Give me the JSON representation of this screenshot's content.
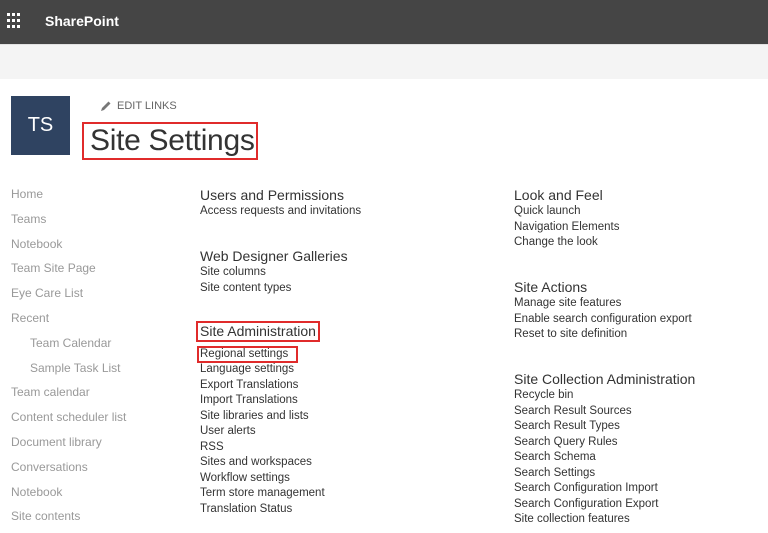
{
  "suite_bar": {
    "brand": "SharePoint",
    "waffle_icon": "app-launcher-icon"
  },
  "header": {
    "logo_initials": "TS",
    "edit_links_label": "EDIT LINKS",
    "page_title": "Site Settings"
  },
  "quick_launch": {
    "items": [
      {
        "label": "Home",
        "indent": false
      },
      {
        "label": "Teams",
        "indent": false
      },
      {
        "label": "Notebook",
        "indent": false
      },
      {
        "label": "Team Site Page",
        "indent": false
      },
      {
        "label": "Eye Care List",
        "indent": false
      },
      {
        "label": "Recent",
        "indent": false
      },
      {
        "label": "Team Calendar",
        "indent": true
      },
      {
        "label": "Sample Task List",
        "indent": true
      },
      {
        "label": "Team calendar",
        "indent": false
      },
      {
        "label": "Content scheduler list",
        "indent": false
      },
      {
        "label": "Document library",
        "indent": false
      },
      {
        "label": "Conversations",
        "indent": false
      },
      {
        "label": "Notebook",
        "indent": false
      },
      {
        "label": "Site contents",
        "indent": false
      }
    ]
  },
  "columns": {
    "left": {
      "users_permissions": {
        "title": "Users and Permissions",
        "links": [
          "Access requests and invitations"
        ]
      },
      "web_designer_galleries": {
        "title": "Web Designer Galleries",
        "links": [
          "Site columns",
          "Site content types"
        ]
      },
      "site_administration": {
        "title": "Site Administration",
        "links": [
          "Regional settings",
          "Language settings",
          "Export Translations",
          "Import Translations",
          "Site libraries and lists",
          "User alerts",
          "RSS",
          "Sites and workspaces",
          "Workflow settings",
          "Term store management",
          "Translation Status"
        ]
      }
    },
    "right": {
      "look_and_feel": {
        "title": "Look and Feel",
        "links": [
          "Quick launch",
          "Navigation Elements",
          "Change the look"
        ]
      },
      "site_actions": {
        "title": "Site Actions",
        "links": [
          "Manage site features",
          "Enable search configuration export",
          "Reset to site definition"
        ]
      },
      "site_collection_administration": {
        "title": "Site Collection Administration",
        "links": [
          "Recycle bin",
          "Search Result Sources",
          "Search Result Types",
          "Search Query Rules",
          "Search Schema",
          "Search Settings",
          "Search Configuration Import",
          "Search Configuration Export",
          "Site collection features"
        ]
      }
    }
  },
  "colors": {
    "suite_bar": "#454545",
    "logo_bg": "#2f4361",
    "highlight_box": "#e02b2b"
  }
}
